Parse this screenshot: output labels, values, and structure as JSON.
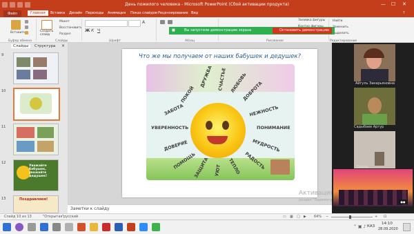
{
  "window": {
    "title": "День пожилого человека - Microsoft PowerPoint (Сбой активации продукта)",
    "minimize": "—",
    "maximize": "☐",
    "close": "✕"
  },
  "ribbon": {
    "tabs": [
      "Файл",
      "Главная",
      "Вставка",
      "Дизайн",
      "Переходы",
      "Анимация",
      "Показ слайдов",
      "Рецензирование",
      "Вид"
    ],
    "active_tab": "Главная",
    "clipboard": {
      "paste": "Вставить",
      "group": "Буфер обмена"
    },
    "slides": {
      "create": "Создать слайд",
      "layout": "Макет",
      "reset": "Восстановить",
      "section": "Раздел",
      "group": "Слайды"
    },
    "font_group": "Шрифт",
    "paragraph_group": "Абзац",
    "drawing_group": "Рисование",
    "editing": {
      "find": "Найти",
      "replace": "Заменить",
      "select": "Выделить",
      "group": "Редактирование"
    },
    "shape_fill": "Заливка фигуры",
    "shape_outline": "Контур фигуры",
    "shape_effects": "Эффекты фигур",
    "font_size": "A"
  },
  "share_banner": {
    "message": "Вы запустили демонстрацию экрана",
    "stop": "Остановить демонстрацию"
  },
  "sidebar": {
    "tabs": [
      "Слайды",
      "Структура"
    ],
    "slides": [
      {
        "num": "9"
      },
      {
        "num": "10",
        "selected": true
      },
      {
        "num": "11"
      },
      {
        "num": "12",
        "caption": "Уважайте бабушек, уважайте дедушек!"
      },
      {
        "num": "13",
        "caption": "Поздравляем!"
      }
    ]
  },
  "slide": {
    "title": "Что же мы получаем от наших бабушек и дедушек?",
    "words": [
      "ДРУЖБА",
      "СЧАСТЬЕ",
      "ЛЮБОВЬ",
      "ДОБРОТА",
      "ПОКОЙ",
      "ЗАБОТА",
      "НЕЖНОСТЬ",
      "УВЕРЕННОСТЬ",
      "ПОНИМАНИЕ",
      "ДОВЕРИЕ",
      "МУДРОСТЬ",
      "ПОМОЩЬ",
      "РАДОСТЬ",
      "ЗАЩИТА",
      "УЮТ",
      "ТЕПЛО"
    ]
  },
  "watermark": {
    "line1": "Активация Windows",
    "line2": "раздел \"Параметры\". Дазшо 3"
  },
  "notes": {
    "placeholder": "Заметки к слайду"
  },
  "participants": [
    {
      "name": "Айгуль Закарьяновна"
    },
    {
      "name": "Садыбаев Артур"
    },
    {
      "name": "Ералы"
    }
  ],
  "status": {
    "slide_info": "Слайд 10 из 13",
    "theme": "\"Открытая\"",
    "language": "русский",
    "zoom": "64%"
  },
  "taskbar": {
    "language": "КАЗ",
    "time": "14:10",
    "date": "28.09.2020"
  },
  "colors": {
    "ppt_accent": "#c43e1c",
    "share_green": "#2db050",
    "stop_red": "#d9321d",
    "title_blue": "#2c5e95"
  }
}
